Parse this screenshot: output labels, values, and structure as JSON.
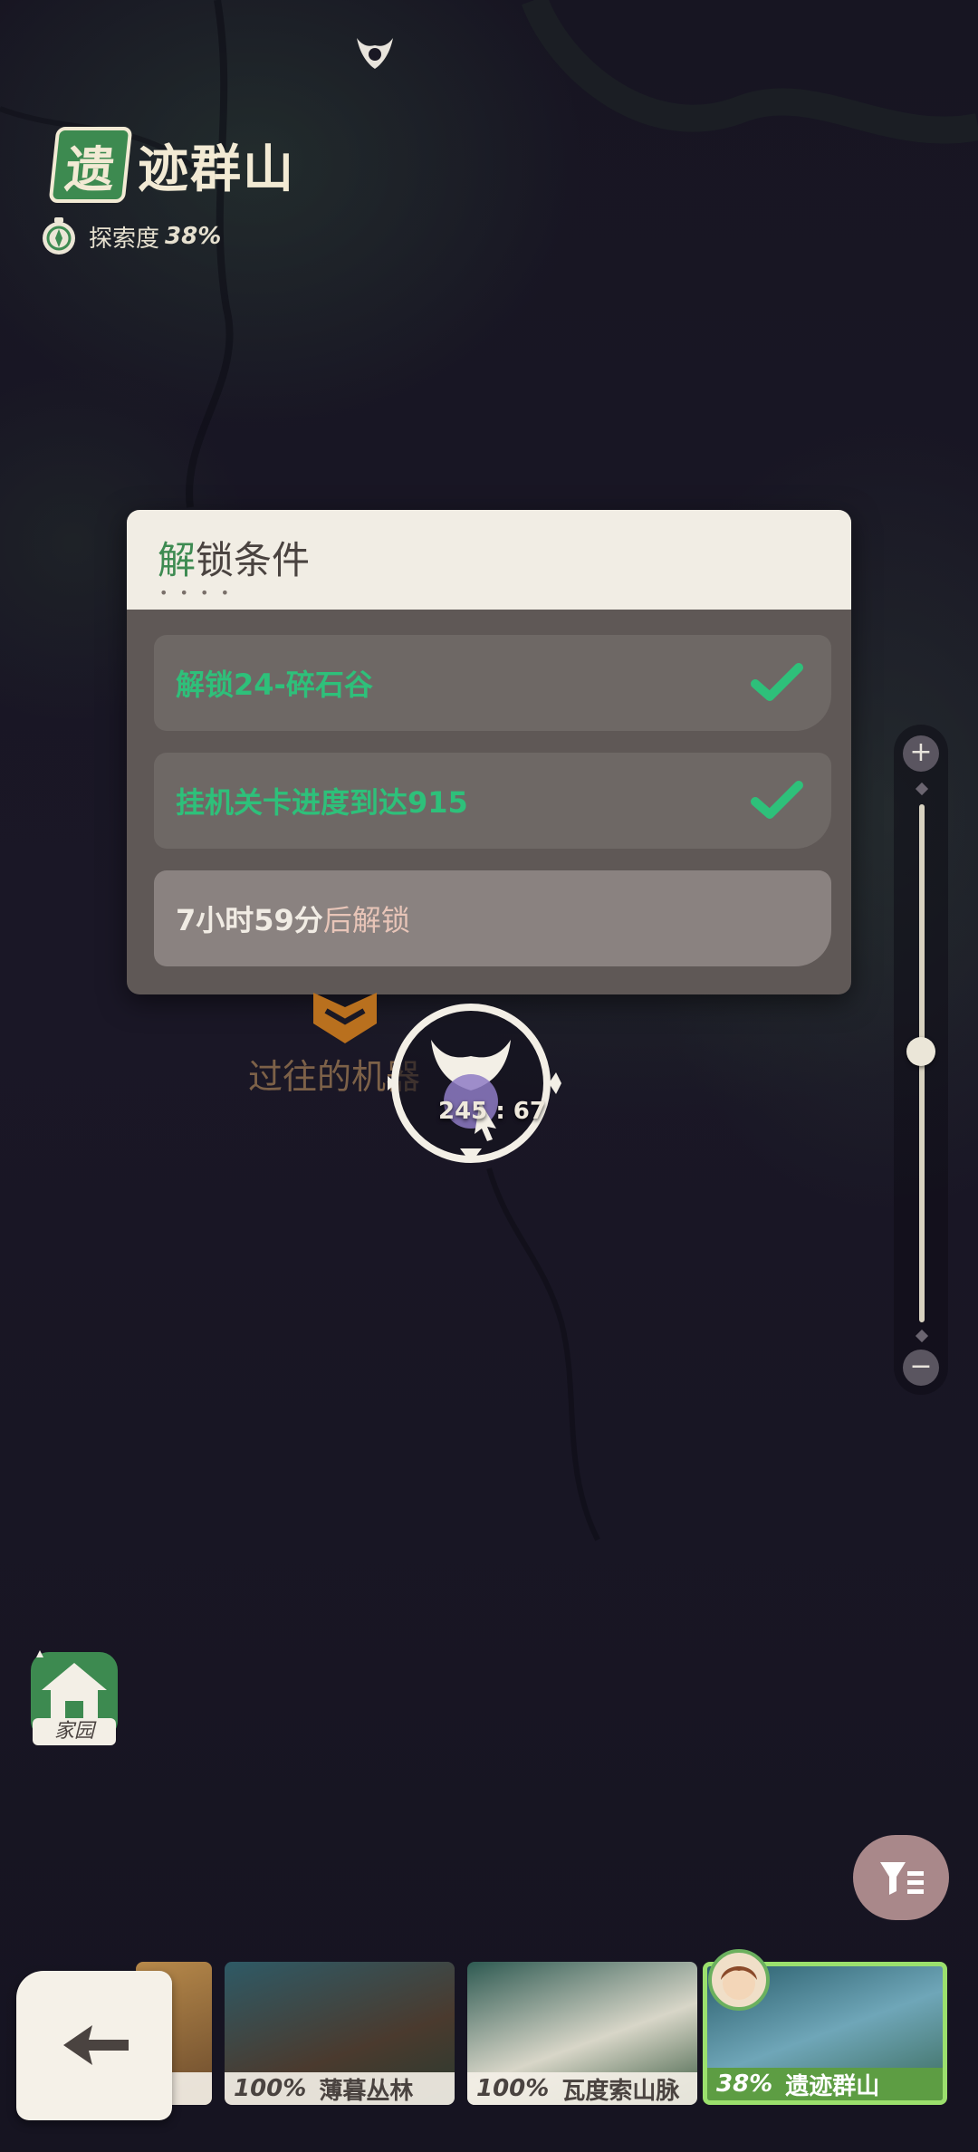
{
  "region": {
    "badge_char": "遗",
    "name_rest": "迹群山",
    "explore_label": "探索度",
    "explore_pct": "38%"
  },
  "unlock_panel": {
    "title_first": "解",
    "title_rest": "锁条件",
    "dots": "• • • •",
    "conditions": [
      {
        "text": "解锁24-碎石谷",
        "done": true
      },
      {
        "text": "挂机关卡进度到达915",
        "done": true
      },
      {
        "text": "7小时59分",
        "suffix": "后解锁",
        "done": false
      }
    ]
  },
  "map": {
    "place_label": "过往的机器",
    "coord": "245 : 67"
  },
  "zoom": {
    "plus": "+",
    "minus": "−",
    "level": 0.32
  },
  "home": {
    "label": "家园"
  },
  "bottom_regions": [
    {
      "pct": "",
      "name": "原"
    },
    {
      "pct": "100%",
      "name": "薄暮丛林"
    },
    {
      "pct": "100%",
      "name": "瓦度索山脉"
    },
    {
      "pct": "38%",
      "name": "遗迹群山",
      "active": true
    }
  ],
  "colors": {
    "accent_green": "#2ec07a",
    "panel_bg": "#5f5856",
    "header_bg": "#f1ede4"
  }
}
